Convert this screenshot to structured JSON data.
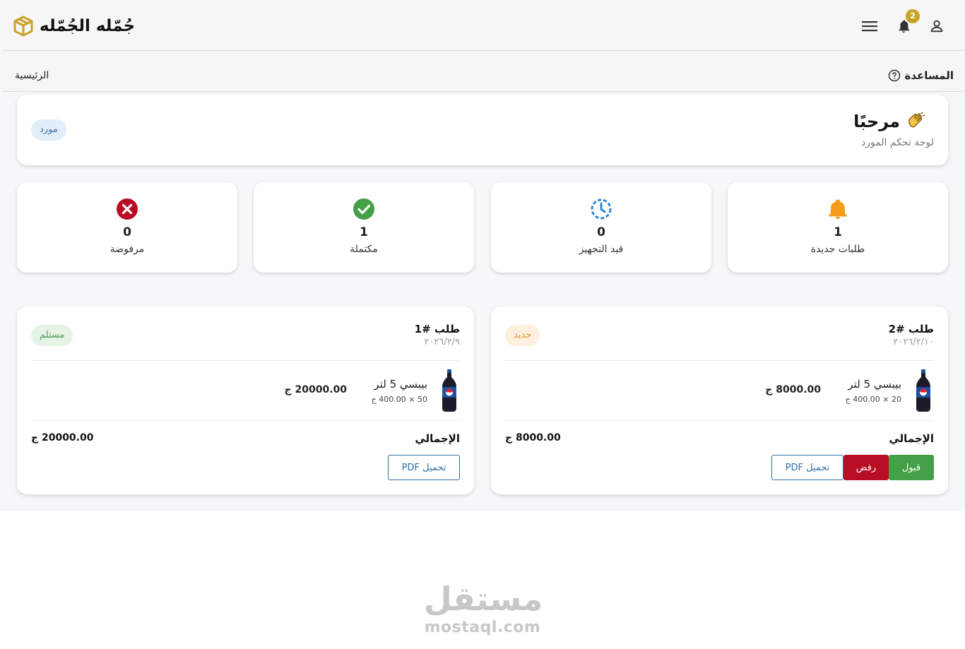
{
  "header": {
    "logo_text": "جُمّله الجُمّله",
    "notification_count": "2"
  },
  "breadcrumb": {
    "help_label": "المساعدة",
    "home_label": "الرئيسية"
  },
  "welcome": {
    "title": "مرحبًا",
    "subtitle": "لوحة تحكم المورد",
    "role": "مورد"
  },
  "stats": [
    {
      "label": "طلبات جديدة",
      "value": "1",
      "icon": "bell-icon",
      "color": "#f59c1a"
    },
    {
      "label": "قيد التجهيز",
      "value": "0",
      "icon": "clock-icon",
      "color": "#2e86de"
    },
    {
      "label": "مكتملة",
      "value": "1",
      "icon": "check-circle-icon",
      "color": "#43a047"
    },
    {
      "label": "مرفوضة",
      "value": "0",
      "icon": "close-circle-icon",
      "color": "#b80d24"
    }
  ],
  "orders": [
    {
      "title": "طلب #2",
      "date": "٢٠٢٦/٢/١٠",
      "status": "جديد",
      "item_name": "بيبسي 5 لتر",
      "item_qty": "20 × 400.00 ج",
      "item_total": "8000.00 ج",
      "total_label": "الإجمالي",
      "total_value": "8000.00 ج",
      "pdf_label": "تحميل PDF",
      "reject_label": "رفض",
      "accept_label": "قبول"
    },
    {
      "title": "طلب #1",
      "date": "٢٠٢٦/٢/٩",
      "status": "مستلم",
      "item_name": "بيبسي 5 لتر",
      "item_qty": "50 × 400.00 ج",
      "item_total": "20000.00 ج",
      "total_label": "الإجمالي",
      "total_value": "20000.00 ج",
      "pdf_label": "تحميل PDF"
    }
  ],
  "watermark": {
    "arabic": "مستقل",
    "latin": "mostaql.com"
  },
  "colors": {
    "brand_gold": "#c9a227",
    "accept_green": "#43a047",
    "reject_red": "#b80d24",
    "link_blue": "#2f6ea8"
  }
}
